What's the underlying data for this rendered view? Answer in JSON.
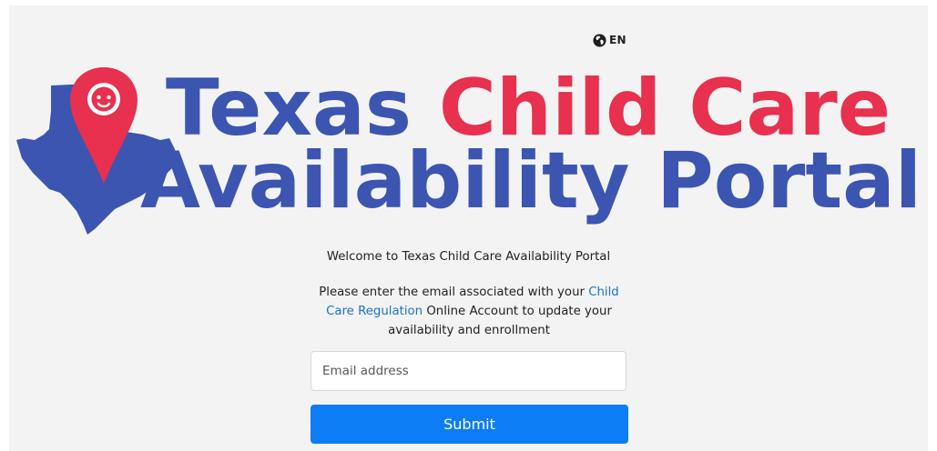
{
  "language": {
    "label": "EN",
    "icon": "globe-icon"
  },
  "logo": {
    "line1_blue": "Texas",
    "line1_red": "Child Care",
    "line2_blue": "Availability Portal",
    "icon": "map-pin-baby-icon",
    "colors": {
      "blue": "#3b55b1",
      "red": "#e8304f"
    }
  },
  "welcome_text": "Welcome to Texas Child Care Availability Portal",
  "instructions": {
    "before_link": "Please enter the email associated with your ",
    "link_text": "Child Care Regulation",
    "after_link": " Online Account to update your availability and enrollment"
  },
  "form": {
    "email_placeholder": "Email address",
    "submit_label": "Submit"
  },
  "colors": {
    "page_background": "#f3f3f3",
    "button": "#0d7df5",
    "link": "#1a73c9"
  }
}
